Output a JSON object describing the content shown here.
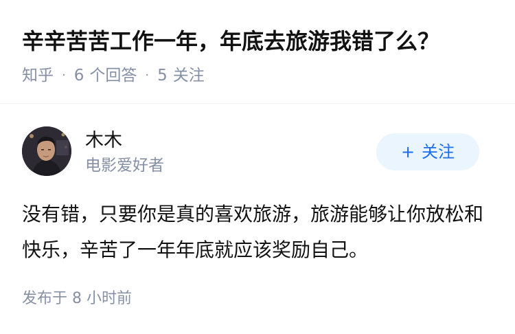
{
  "question": {
    "title": "辛辛苦苦工作一年，年底去旅游我错了么？",
    "source": "知乎",
    "separator": "·",
    "answers_count": "6",
    "answers_label": "个回答",
    "followers_count": "5",
    "followers_label": "关注"
  },
  "author": {
    "name": "木木",
    "bio": "电影爱好者",
    "avatar_icon": "user-avatar-photo",
    "follow_icon": "plus-icon",
    "follow_plus": "+",
    "follow_label": "关注"
  },
  "answer": {
    "content": "没有错，只要你是真的喜欢旅游，旅游能够让你放松和快乐，辛苦了一年年底就应该奖励自己。"
  },
  "footer": {
    "published_label": "发布于",
    "published_time": "8 小时前"
  },
  "colors": {
    "primary_text": "#121212",
    "secondary_text": "#8590a6",
    "brand_blue": "#1a6ef5",
    "follow_bg": "#ebf5fd"
  }
}
